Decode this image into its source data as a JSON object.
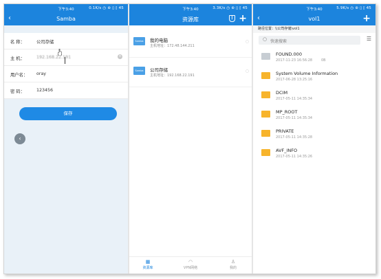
{
  "colors": {
    "primary": "#1c84dd",
    "folder": "#f7b42c"
  },
  "status": {
    "time": "下午3:40",
    "p1_right": "0.1K/s ◷ ⊛ ▯ ⁅ 45",
    "p2_right": "3.3K/s ◷ ⊛ ▯ ⁅ 45",
    "p3_right": "5.9K/s ◷ ⊛ ▯ ⁅ 45"
  },
  "samba": {
    "title": "Samba",
    "fields": [
      {
        "label": "名   称：",
        "value": "公司存储"
      },
      {
        "label": "主   机：",
        "value": "192.168.22.191"
      },
      {
        "label": "用户名：",
        "value": "oray"
      },
      {
        "label": "密   码：",
        "value": "123456"
      }
    ],
    "save_label": "保存"
  },
  "repo": {
    "title": "资源库",
    "items": [
      {
        "name": "我的电脑",
        "addr": "主机地址：172.48.144.211",
        "badge": "Samba"
      },
      {
        "name": "公司存储",
        "addr": "主机地址：192.168.22.191",
        "badge": "Samba"
      }
    ],
    "tabs": [
      {
        "icon": "▦",
        "label": "资源库"
      },
      {
        "icon": "◠",
        "label": "VPN网络"
      },
      {
        "icon": "♙",
        "label": "我的"
      }
    ]
  },
  "vol": {
    "title": "vol1",
    "path": "路径位置：\\\\公司存储\\vol1",
    "search_placeholder": "快速搜索",
    "files": [
      {
        "name": "FOUND.000",
        "meta": "2017-11-23 16:56:28",
        "size": "0B",
        "type": "file"
      },
      {
        "name": "System Volume Information",
        "meta": "2017-06-28 13:25:16",
        "size": "",
        "type": "folder"
      },
      {
        "name": "DCIM",
        "meta": "2017-05-11 14:35:34",
        "size": "",
        "type": "folder"
      },
      {
        "name": "MP_ROOT",
        "meta": "2017-05-11 14:35:34",
        "size": "",
        "type": "folder"
      },
      {
        "name": "PRIVATE",
        "meta": "2017-05-11 14:35:28",
        "size": "",
        "type": "folder"
      },
      {
        "name": "AVF_INFO",
        "meta": "2017-05-11 14:35:26",
        "size": "",
        "type": "folder"
      }
    ]
  }
}
